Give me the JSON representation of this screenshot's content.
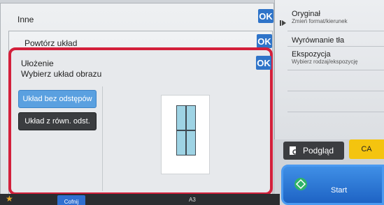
{
  "dialogs": {
    "inne": {
      "title": "Inne",
      "ok": "OK"
    },
    "powtorz": {
      "title": "Powtórz układ",
      "ok": "OK"
    },
    "ulozenie": {
      "title": "Ułożenie",
      "subtitle": "Wybierz układ obrazu",
      "ok": "OK",
      "options": [
        "Układ bez odstępów",
        "Układ z równ. odst."
      ],
      "selected_option": "Układ bez odstępów"
    }
  },
  "right_panel": {
    "original": {
      "label": "Oryginał",
      "sub": "Zmień format/kierunek"
    },
    "wyrownanie": {
      "label": "Wyrównanie tła"
    },
    "ekspozycja": {
      "label": "Ekspozycja",
      "sub": "Wybierz rodzaj/ekspozycję"
    }
  },
  "buttons": {
    "podglad": "Podgląd",
    "ca": "CA",
    "start": "Start"
  },
  "bottom_bar": {
    "back": "Cofnij",
    "paper": "A3"
  },
  "colors": {
    "highlight": "#d3203b",
    "ok": "#2f74c9",
    "start": "#1e63c4",
    "ca": "#f4c40f",
    "selected": "#5aa0e0"
  }
}
